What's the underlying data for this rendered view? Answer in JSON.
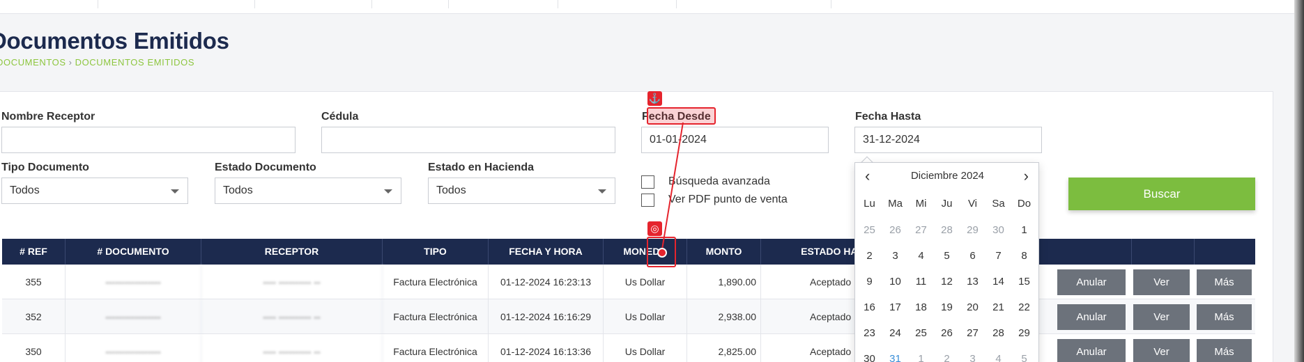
{
  "page": {
    "title": "Documentos Emitidos",
    "breadcrumb": {
      "parent": "DOCUMENTOS",
      "separator": "›",
      "current": "DOCUMENTOS EMITIDOS"
    }
  },
  "filters": {
    "nombre_receptor": {
      "label": "Nombre Receptor",
      "value": ""
    },
    "cedula": {
      "label": "Cédula",
      "value": ""
    },
    "fecha_desde": {
      "label": "Fecha Desde",
      "value": "01-01-2024"
    },
    "fecha_hasta": {
      "label": "Fecha Hasta",
      "value": "31-12-2024"
    },
    "tipo_documento": {
      "label": "Tipo Documento",
      "value": "Todos"
    },
    "estado_documento": {
      "label": "Estado Documento",
      "value": "Todos"
    },
    "estado_hacienda": {
      "label": "Estado en Hacienda",
      "value": "Todos"
    },
    "busqueda_avanzada": {
      "label": "Búsqueda avanzada",
      "checked": false
    },
    "ver_pdf": {
      "label": "Ver PDF punto de venta",
      "checked": false
    },
    "buscar_label": "Buscar"
  },
  "datepicker": {
    "month_label": "Diciembre 2024",
    "prev": "‹",
    "next": "›",
    "days_of_week": [
      "Lu",
      "Ma",
      "Mi",
      "Ju",
      "Vi",
      "Sa",
      "Do"
    ],
    "weeks": [
      [
        "25",
        "26",
        "27",
        "28",
        "29",
        "30",
        "1"
      ],
      [
        "2",
        "3",
        "4",
        "5",
        "6",
        "7",
        "8"
      ],
      [
        "9",
        "10",
        "11",
        "12",
        "13",
        "14",
        "15"
      ],
      [
        "16",
        "17",
        "18",
        "19",
        "20",
        "21",
        "22"
      ],
      [
        "23",
        "24",
        "25",
        "26",
        "27",
        "28",
        "29"
      ],
      [
        "30",
        "31",
        "1",
        "2",
        "3",
        "4",
        "5"
      ]
    ]
  },
  "table": {
    "headers": [
      "# REF",
      "# DOCUMENTO",
      "RECEPTOR",
      "TIPO",
      "FECHA Y HORA",
      "MONEDA",
      "MONTO",
      "ESTADO HACIE",
      "",
      "",
      ""
    ],
    "rows": [
      {
        "ref": "355",
        "documento": "-----------------",
        "receptor": "---- ---------- --",
        "tipo": "Factura Electrónica",
        "fecha": "01-12-2024 16:23:13",
        "moneda": "Us Dollar",
        "monto": "1,890.00",
        "estado": "Aceptado"
      },
      {
        "ref": "352",
        "documento": "-----------------",
        "receptor": "---- ---------- --",
        "tipo": "Factura Electrónica",
        "fecha": "01-12-2024 16:16:29",
        "moneda": "Us Dollar",
        "monto": "2,938.00",
        "estado": "Aceptado"
      },
      {
        "ref": "350",
        "documento": "-----------------",
        "receptor": "---- ---------- --",
        "tipo": "Factura Electrónica",
        "fecha": "01-12-2024 16:13:36",
        "moneda": "Us Dollar",
        "monto": "2,825.00",
        "estado": "Aceptado"
      }
    ],
    "row_actions": {
      "anular": "Anular",
      "ver": "Ver",
      "mas": "Más"
    }
  },
  "annotations": {
    "anchor_icon": "anchor-icon",
    "target_icon": "target-icon",
    "color": "#e5242d"
  }
}
